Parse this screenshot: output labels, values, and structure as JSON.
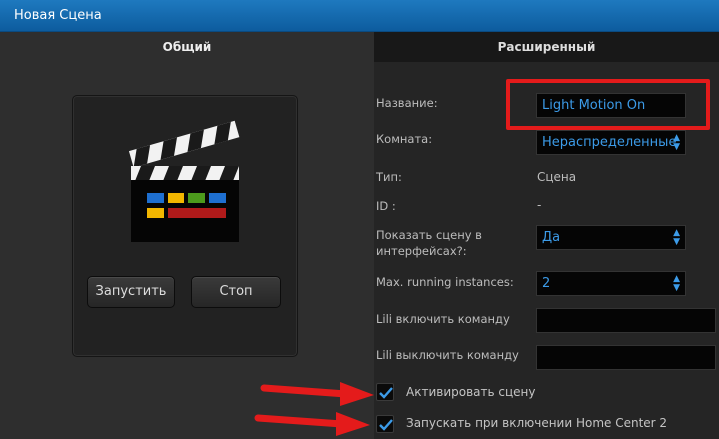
{
  "window": {
    "title": "Новая Сцена"
  },
  "tabs": [
    {
      "label": "Общий",
      "active": true
    },
    {
      "label": "Расширенный",
      "active": false
    }
  ],
  "scene": {
    "icon": "clapperboard-icon",
    "run_label": "Запустить",
    "stop_label": "Стоп"
  },
  "form": {
    "name_label": "Название:",
    "name_value": "Light Motion On",
    "room_label": "Комната:",
    "room_value": "Нераспределенные",
    "type_label": "Тип:",
    "type_value": "Сцена",
    "id_label": "ID :",
    "id_value": "-",
    "show_label": "Показать сцену в интерфейсах?:",
    "show_value": "Да",
    "max_label": "Max. running instances:",
    "max_value": "2",
    "lili_on_label": "Lili включить команду",
    "lili_on_value": "",
    "lili_off_label": "Lili выключить команду",
    "lili_off_value": ""
  },
  "checkboxes": {
    "activate_label": "Активировать сцену",
    "activate_checked": true,
    "startup_label": "Запускать при включении Home Center 2",
    "startup_checked": true
  },
  "colors": {
    "titlebar": "#1a70b5",
    "accent_text": "#3c9be8",
    "annotation": "#e41b1b"
  }
}
